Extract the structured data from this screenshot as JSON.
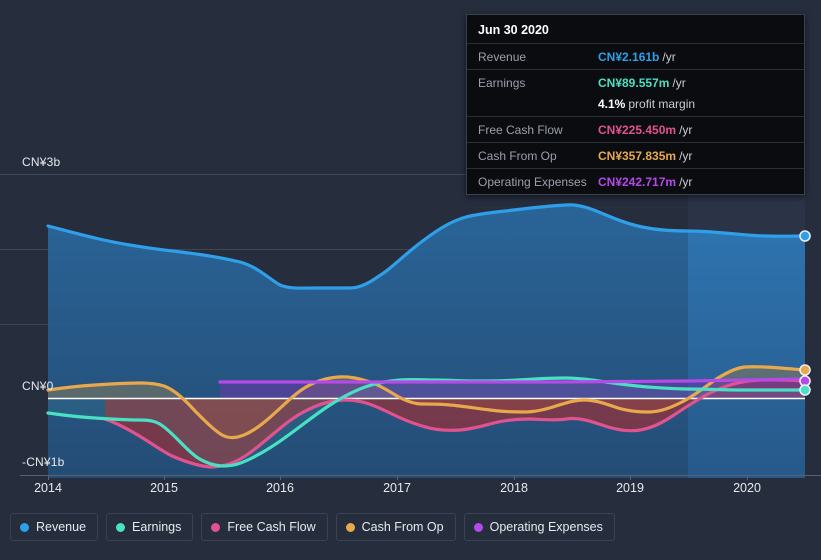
{
  "currency": "CN¥",
  "tooltip": {
    "title": "Jun 30 2020",
    "rows": [
      {
        "key": "Revenue",
        "value": "CN¥2.161b",
        "unit": "/yr",
        "color": "#2e9fe8"
      },
      {
        "key": "Earnings",
        "value": "CN¥89.557m",
        "unit": "/yr",
        "color": "#4ae0c3"
      },
      {
        "key": "",
        "value": "4.1%",
        "unit": "",
        "sub": "profit margin",
        "color": "#ffffff"
      },
      {
        "key": "Free Cash Flow",
        "value": "CN¥225.450m",
        "unit": "/yr",
        "color": "#e0538f"
      },
      {
        "key": "Cash From Op",
        "value": "CN¥357.835m",
        "unit": "/yr",
        "color": "#e8a84c"
      },
      {
        "key": "Operating Expenses",
        "value": "CN¥242.717m",
        "unit": "/yr",
        "color": "#b44ae8"
      }
    ]
  },
  "legend": {
    "items": [
      {
        "label": "Revenue",
        "color": "#2e9fe8",
        "icon": "legend-dot-icon"
      },
      {
        "label": "Earnings",
        "color": "#4ae0c3",
        "icon": "legend-dot-icon"
      },
      {
        "label": "Free Cash Flow",
        "color": "#e0538f",
        "icon": "legend-dot-icon"
      },
      {
        "label": "Cash From Op",
        "color": "#e8a84c",
        "icon": "legend-dot-icon"
      },
      {
        "label": "Operating Expenses",
        "color": "#b44ae8",
        "icon": "legend-dot-icon"
      }
    ]
  },
  "chart_data": {
    "type": "area",
    "title": "",
    "xlabel": "",
    "ylabel": "CN¥",
    "grid": true,
    "legend_position": "bottom",
    "xlim": [
      2013.7,
      2020.5
    ],
    "ylim": [
      -1.15,
      3.0
    ],
    "yticks": [
      3,
      2,
      1,
      0,
      -1
    ],
    "ytick_labels": [
      "CN¥3b",
      "",
      "",
      "CN¥0",
      "-CN¥1b"
    ],
    "x_tick_labels": [
      "2014",
      "2015",
      "2016",
      "2017",
      "2018",
      "2019",
      "2020"
    ],
    "x_ticks": [
      2014,
      2015,
      2016,
      2017,
      2018,
      2019,
      2020
    ],
    "units": "billions CN¥ (b) per year",
    "highlight_band": {
      "from": 2019.75,
      "to": 2020.5,
      "note": "recent period shading"
    },
    "series": [
      {
        "name": "Revenue",
        "color": "#2e9fe8",
        "fill": "rgba(46,120,190,0.40)",
        "x": [
          2014.0,
          2014.25,
          2014.5,
          2014.75,
          2015.0,
          2015.25,
          2015.5,
          2015.75,
          2016.0,
          2016.25,
          2016.5,
          2016.75,
          2017.0,
          2017.25,
          2017.5,
          2017.75,
          2018.0,
          2018.25,
          2018.5,
          2018.75,
          2019.0,
          2019.25,
          2019.5,
          2019.75,
          2020.0,
          2020.25,
          2020.5
        ],
        "values": [
          2.305,
          2.27,
          2.235,
          2.205,
          2.18,
          2.165,
          2.15,
          2.12,
          2.03,
          1.945,
          1.93,
          1.93,
          1.985,
          2.095,
          2.285,
          2.41,
          2.45,
          2.49,
          2.585,
          2.56,
          2.46,
          2.39,
          2.355,
          2.34,
          2.32,
          2.24,
          2.161
        ]
      },
      {
        "name": "Earnings",
        "color": "#4ae0c3",
        "fill": "rgba(74,224,195,0.12)",
        "x": [
          2014.0,
          2014.25,
          2014.5,
          2014.75,
          2015.0,
          2015.25,
          2015.5,
          2015.75,
          2016.0,
          2016.25,
          2016.5,
          2016.75,
          2017.0,
          2017.25,
          2017.5,
          2017.75,
          2018.0,
          2018.25,
          2018.5,
          2018.75,
          2019.0,
          2019.25,
          2019.5,
          2019.75,
          2020.0,
          2020.25,
          2020.5
        ],
        "values": [
          -0.2,
          -0.23,
          -0.25,
          -0.265,
          -0.43,
          -0.69,
          -0.86,
          -0.87,
          -0.8,
          -0.68,
          -0.53,
          -0.37,
          -0.19,
          -0.04,
          0.075,
          0.14,
          0.16,
          0.18,
          0.255,
          0.23,
          0.165,
          0.11,
          0.075,
          0.05,
          0.06,
          0.08,
          0.09
        ]
      },
      {
        "name": "Free Cash Flow",
        "color": "#e0538f",
        "fill": "rgba(168,52,62,0.55)",
        "x": [
          2014.5,
          2014.75,
          2015.0,
          2015.25,
          2015.5,
          2015.75,
          2016.0,
          2016.25,
          2016.5,
          2016.75,
          2017.0,
          2017.25,
          2017.5,
          2017.75,
          2018.0,
          2018.25,
          2018.5,
          2018.75,
          2019.0,
          2019.25,
          2019.5,
          2019.75,
          2020.0,
          2020.25,
          2020.5
        ],
        "values": [
          -0.28,
          -0.33,
          -0.52,
          -0.79,
          -0.91,
          -0.905,
          -0.8,
          -0.62,
          -0.4,
          -0.21,
          -0.125,
          -0.1,
          -0.14,
          -0.23,
          -0.32,
          -0.39,
          -0.4,
          -0.405,
          -0.43,
          -0.4,
          -0.31,
          -0.16,
          0.02,
          0.15,
          0.225
        ]
      },
      {
        "name": "Cash From Op",
        "color": "#e8a84c",
        "fill": "rgba(120,115,95,0.45)",
        "x": [
          2014.0,
          2014.25,
          2014.5,
          2014.75,
          2015.0,
          2015.25,
          2015.5,
          2015.75,
          2016.0,
          2016.25,
          2016.5,
          2016.75,
          2017.0,
          2017.25,
          2017.5,
          2017.75,
          2018.0,
          2018.25,
          2018.5,
          2018.75,
          2019.0,
          2019.25,
          2019.5,
          2019.75,
          2020.0,
          2020.25,
          2020.5
        ],
        "values": [
          0.11,
          0.13,
          0.15,
          0.155,
          0.05,
          -0.18,
          -0.43,
          -0.52,
          -0.5,
          -0.42,
          -0.27,
          -0.08,
          0.08,
          0.14,
          0.12,
          0.045,
          -0.04,
          -0.105,
          -0.12,
          -0.13,
          -0.175,
          -0.175,
          -0.11,
          0.06,
          0.29,
          0.4,
          0.358
        ]
      },
      {
        "name": "Operating Expenses",
        "color": "#b44ae8",
        "fill": "rgba(120,60,180,0.42)",
        "x": [
          2016.0,
          2016.25,
          2016.5,
          2016.75,
          2017.0,
          2017.25,
          2017.5,
          2017.75,
          2018.0,
          2018.25,
          2018.5,
          2018.75,
          2019.0,
          2019.25,
          2019.5,
          2019.75,
          2020.0,
          2020.25,
          2020.5
        ],
        "values": [
          0.214,
          0.214,
          0.214,
          0.214,
          0.214,
          0.214,
          0.216,
          0.218,
          0.22,
          0.222,
          0.224,
          0.226,
          0.228,
          0.23,
          0.232,
          0.234,
          0.238,
          0.241,
          0.243
        ]
      }
    ]
  },
  "axis": {
    "y_labels": [
      {
        "text": "CN¥3b",
        "value": 3
      },
      {
        "text": "CN¥0",
        "value": 0
      },
      {
        "text": "-CN¥1b",
        "value": -1
      }
    ]
  }
}
